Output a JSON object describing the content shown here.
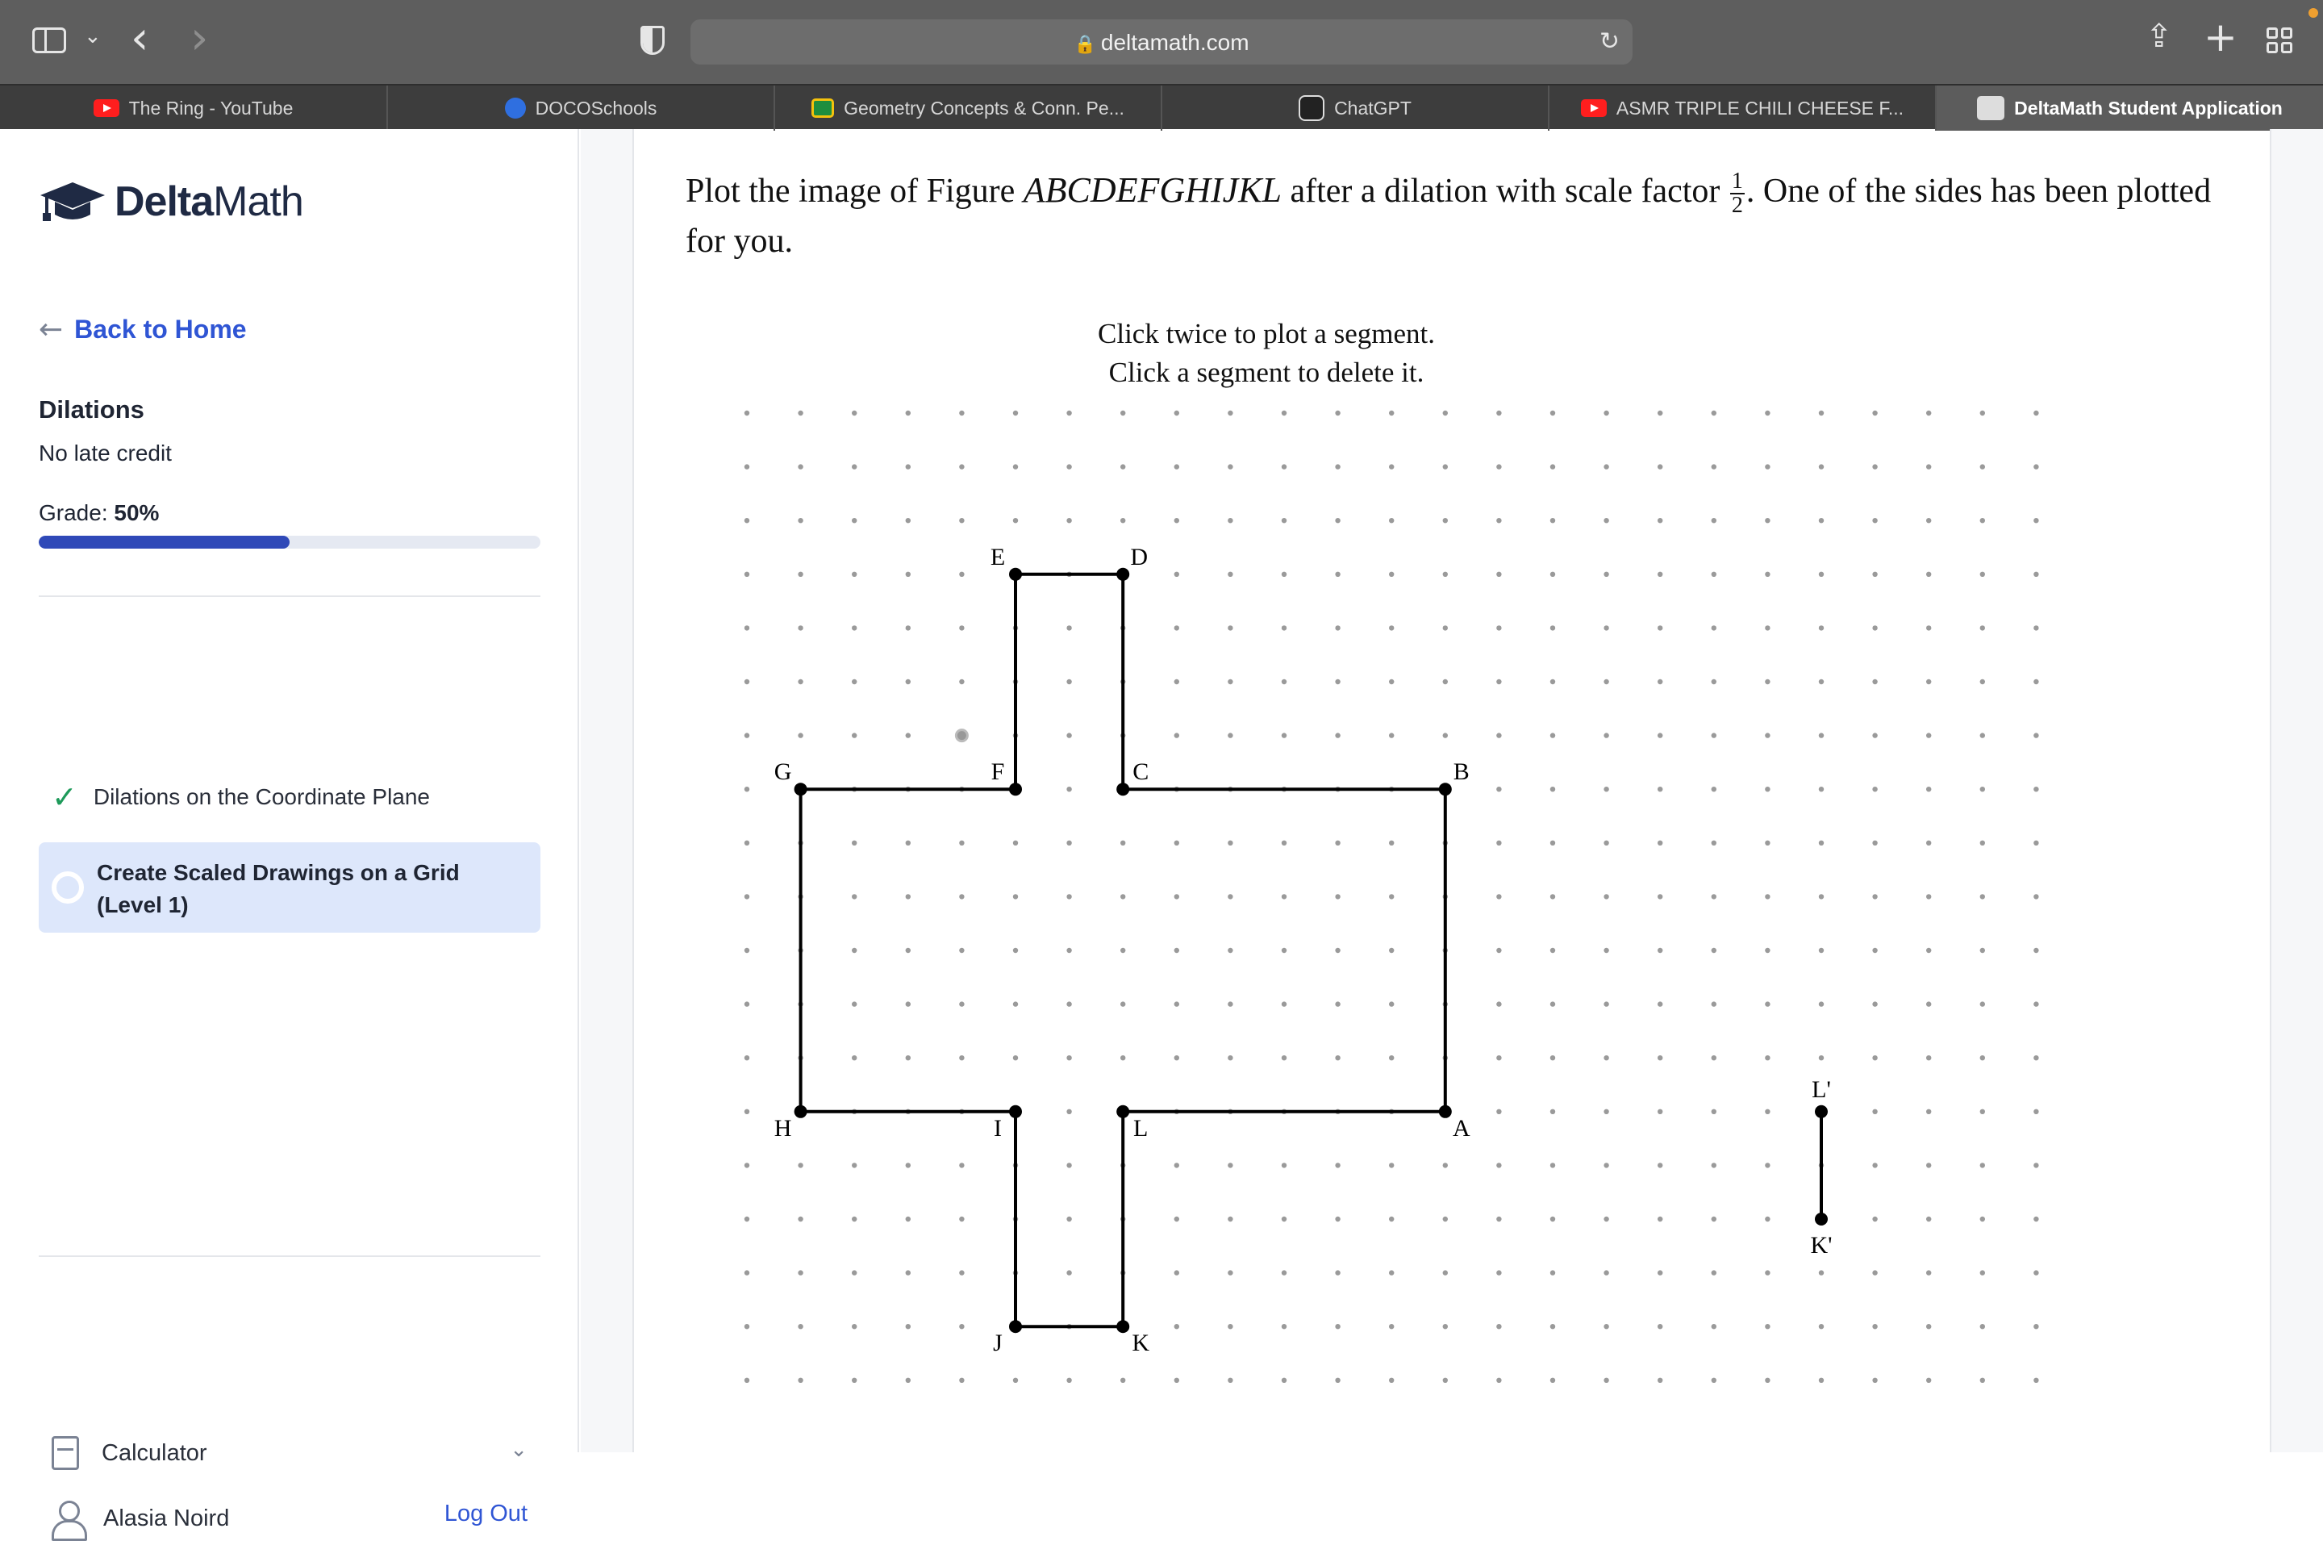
{
  "browser": {
    "url": "deltamath.com",
    "tabs": [
      {
        "label": "The Ring - YouTube",
        "icon": "youtube-icon"
      },
      {
        "label": "DOCOSchools",
        "icon": "docoschools-icon"
      },
      {
        "label": "Geometry Concepts & Conn. Pe...",
        "icon": "google-classroom-icon"
      },
      {
        "label": "ChatGPT",
        "icon": "chatgpt-icon"
      },
      {
        "label": "ASMR TRIPLE CHILI CHEESE F...",
        "icon": "youtube-icon"
      },
      {
        "label": "DeltaMath Student Application",
        "icon": "deltamath-icon"
      }
    ]
  },
  "sidebar": {
    "logo_prefix": "Delta",
    "logo_suffix": "Math",
    "back_label": "Back to Home",
    "assignment_title": "Dilations",
    "late_policy": "No late credit",
    "grade_label": "Grade:",
    "grade_value": "50%",
    "grade_fraction": 0.5,
    "items": [
      {
        "label": "Dilations on the Coordinate Plane",
        "status": "complete"
      },
      {
        "label": "Create Scaled Drawings on a Grid (Level 1)",
        "status": "in-progress"
      }
    ],
    "calculator_label": "Calculator",
    "user_name": "Alasia Noird",
    "logout_label": "Log Out"
  },
  "problem": {
    "text_before": "Plot the image of Figure ",
    "figure_name": "ABCDEFGHIJKL",
    "text_middle": " after a dilation with scale factor ",
    "scale_num": "1",
    "scale_den": "2",
    "text_after": ". One of the sides has been plotted for you.",
    "instruction_1": "Click twice to plot a segment.",
    "instruction_2": "Click a segment to delete it."
  },
  "grid": {
    "columns": 25,
    "rows": 20,
    "figure_vertices": [
      {
        "label": "A",
        "col": 13,
        "row": 13
      },
      {
        "label": "B",
        "col": 13,
        "row": 7
      },
      {
        "label": "C",
        "col": 7,
        "row": 7
      },
      {
        "label": "D",
        "col": 7,
        "row": 3
      },
      {
        "label": "E",
        "col": 5,
        "row": 3
      },
      {
        "label": "F",
        "col": 5,
        "row": 7
      },
      {
        "label": "G",
        "col": 1,
        "row": 7
      },
      {
        "label": "H",
        "col": 1,
        "row": 13
      },
      {
        "label": "I",
        "col": 5,
        "row": 13
      },
      {
        "label": "J",
        "col": 5,
        "row": 17
      },
      {
        "label": "K",
        "col": 7,
        "row": 17
      },
      {
        "label": "L",
        "col": 7,
        "row": 13
      }
    ],
    "image_segment": [
      {
        "label": "L'",
        "col": 20,
        "row": 13
      },
      {
        "label": "K'",
        "col": 20,
        "row": 15
      }
    ],
    "hover_point": {
      "col": 4,
      "row": 6
    }
  }
}
